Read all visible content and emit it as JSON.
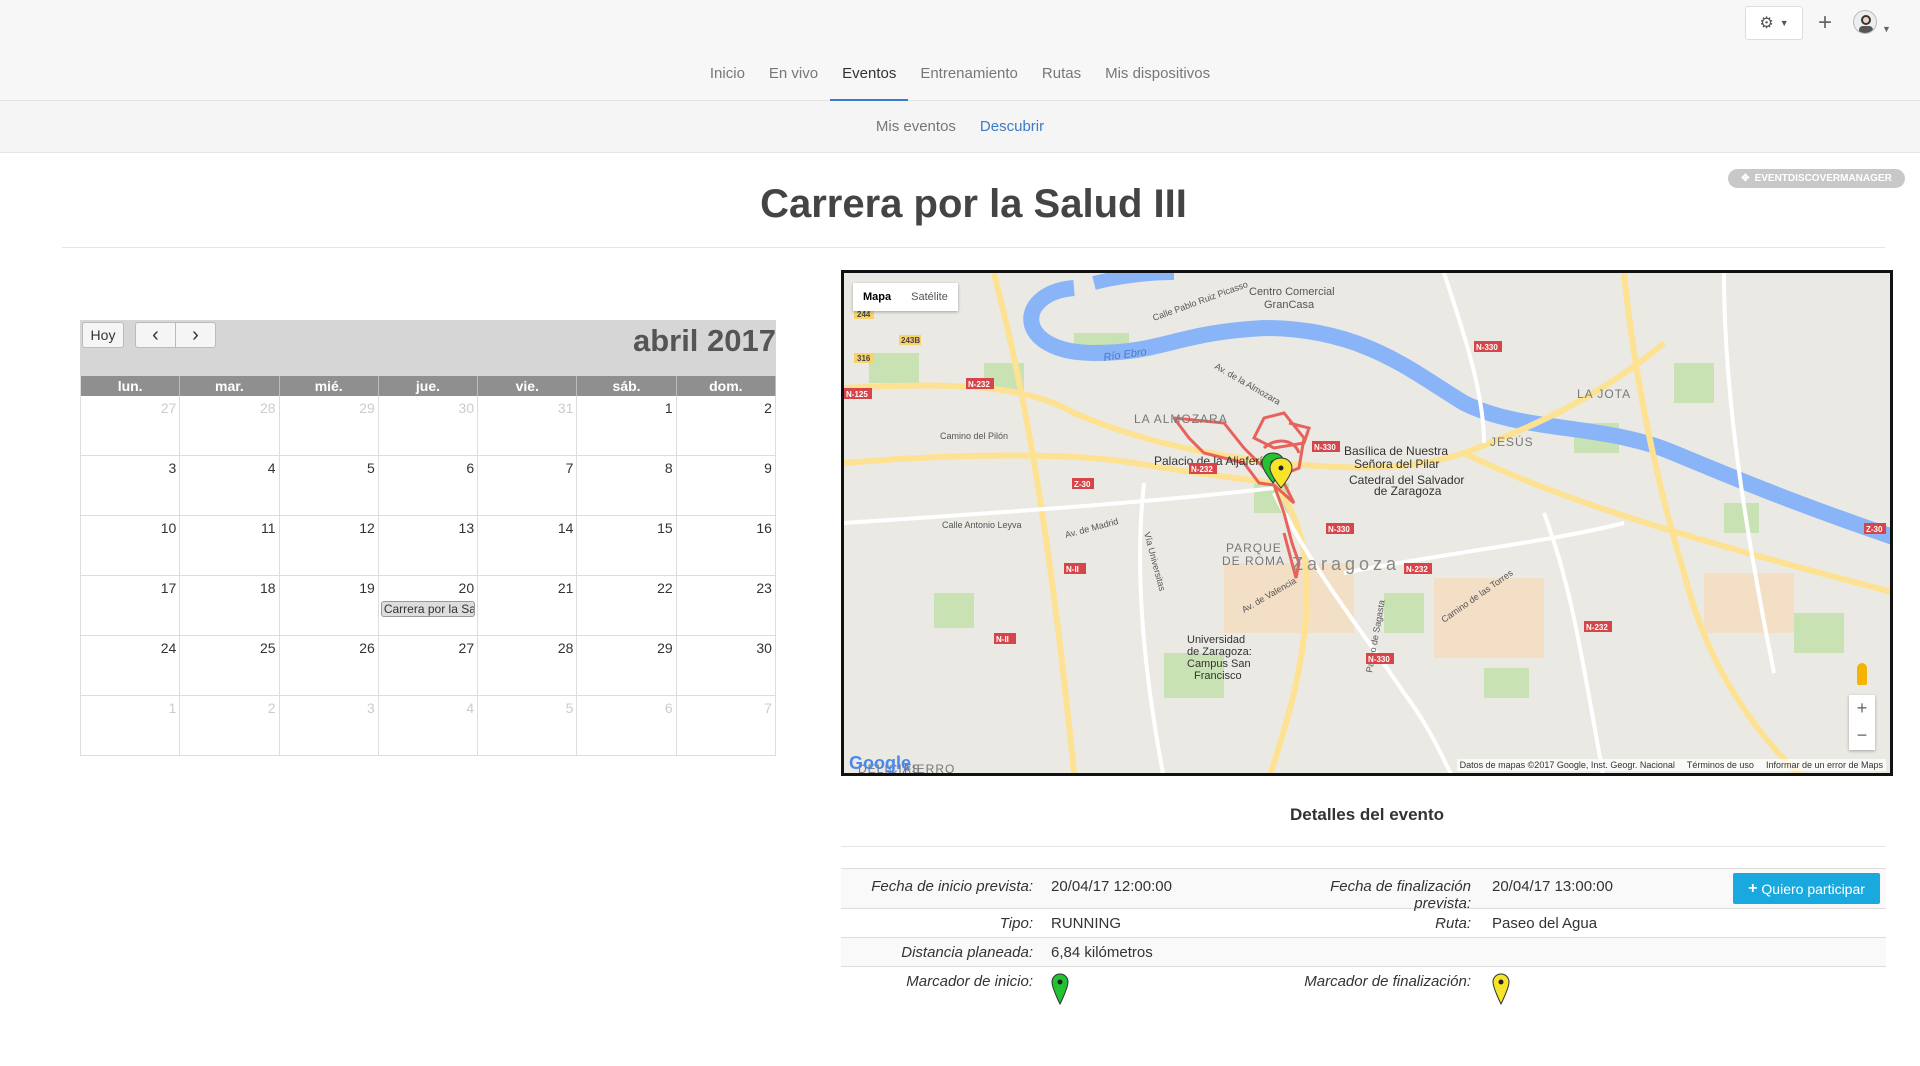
{
  "header": {
    "nav": [
      "Inicio",
      "En vivo",
      "Eventos",
      "Entrenamiento",
      "Rutas",
      "Mis dispositivos"
    ],
    "active_nav": "Eventos",
    "subnav": [
      "Mis eventos",
      "Descubrir"
    ],
    "active_subnav": "Descubrir",
    "manager_badge": "EVENTDISCOVERMANAGER"
  },
  "page": {
    "title": "Carrera por la Salud III"
  },
  "calendar": {
    "today_label": "Hoy",
    "prev_icon": "‹",
    "next_icon": "›",
    "month_title": "abril 2017",
    "weekdays": [
      "lun.",
      "mar.",
      "mié.",
      "jue.",
      "vie.",
      "sáb.",
      "dom."
    ],
    "weeks": [
      [
        {
          "d": "27",
          "o": true
        },
        {
          "d": "28",
          "o": true
        },
        {
          "d": "29",
          "o": true
        },
        {
          "d": "30",
          "o": true
        },
        {
          "d": "31",
          "o": true
        },
        {
          "d": "1"
        },
        {
          "d": "2"
        }
      ],
      [
        {
          "d": "3"
        },
        {
          "d": "4"
        },
        {
          "d": "5"
        },
        {
          "d": "6"
        },
        {
          "d": "7"
        },
        {
          "d": "8"
        },
        {
          "d": "9"
        }
      ],
      [
        {
          "d": "10"
        },
        {
          "d": "11"
        },
        {
          "d": "12"
        },
        {
          "d": "13"
        },
        {
          "d": "14"
        },
        {
          "d": "15"
        },
        {
          "d": "16"
        }
      ],
      [
        {
          "d": "17"
        },
        {
          "d": "18"
        },
        {
          "d": "19"
        },
        {
          "d": "20",
          "event": "Carrera por la Salud III"
        },
        {
          "d": "21"
        },
        {
          "d": "22"
        },
        {
          "d": "23"
        }
      ],
      [
        {
          "d": "24"
        },
        {
          "d": "25"
        },
        {
          "d": "26"
        },
        {
          "d": "27"
        },
        {
          "d": "28"
        },
        {
          "d": "29"
        },
        {
          "d": "30"
        }
      ],
      [
        {
          "d": "1",
          "o": true
        },
        {
          "d": "2",
          "o": true
        },
        {
          "d": "3",
          "o": true
        },
        {
          "d": "4",
          "o": true
        },
        {
          "d": "5",
          "o": true
        },
        {
          "d": "6",
          "o": true
        },
        {
          "d": "7",
          "o": true
        }
      ]
    ]
  },
  "map": {
    "type_buttons": [
      "Mapa",
      "Satélite"
    ],
    "active_type": "Mapa",
    "labels": [
      "Centro Comercial",
      "GranCasa",
      "Río Ebro",
      "LA ALMOZARA",
      "Palacio de la Aljafería",
      "Basílica de Nuestra",
      "Señora del Pilar",
      "Catedral del Salvador",
      "de Zaragoza",
      "LA JOTA",
      "JESÚS",
      "PARQUE",
      "DE ROMA",
      "Zaragoza",
      "Universidad",
      "de Zaragoza:",
      "Campus San",
      "Francisco",
      "Camino del Pilón",
      "Calle Antonio Leyva",
      "Av. de Madrid",
      "Vía Universitas",
      "Av. de Valencia",
      "Paseo de Sagasta",
      "Camino de las Torres",
      "Av. de la Almozara",
      "Calle Pablo Ruiz Picasso",
      "DELICIAS",
      "FIERRO"
    ],
    "road_badges": [
      "244",
      "243B",
      "316",
      "N-232",
      "N-125",
      "N-330",
      "Z-30",
      "N-232",
      "N-II",
      "N-II",
      "N-330",
      "N-232",
      "Z-30",
      "N-232",
      "N-330",
      "N-330"
    ],
    "google": "Google",
    "footer": [
      "Datos de mapas ©2017 Google, Inst. Geogr. Nacional",
      "Términos de uso",
      "Informar de un error de Maps"
    ],
    "zoom_in": "+",
    "zoom_out": "−",
    "route_color": "#e8544f",
    "start_color": "#22c232",
    "end_color": "#f5e42a"
  },
  "details": {
    "title": "Detalles del evento",
    "participate_label": "Quiero participar",
    "rows": {
      "start_label": "Fecha de inicio prevista:",
      "start_value": "20/04/17 12:00:00",
      "end_label": "Fecha de finalización prevista:",
      "end_value": "20/04/17 13:00:00",
      "type_label": "Tipo:",
      "type_value": "RUNNING",
      "route_label": "Ruta:",
      "route_value": "Paseo del Agua",
      "distance_label": "Distancia planeada:",
      "distance_value": "6,84 kilómetros",
      "start_marker_label": "Marcador de inicio:",
      "end_marker_label": "Marcador de finalización:"
    }
  }
}
